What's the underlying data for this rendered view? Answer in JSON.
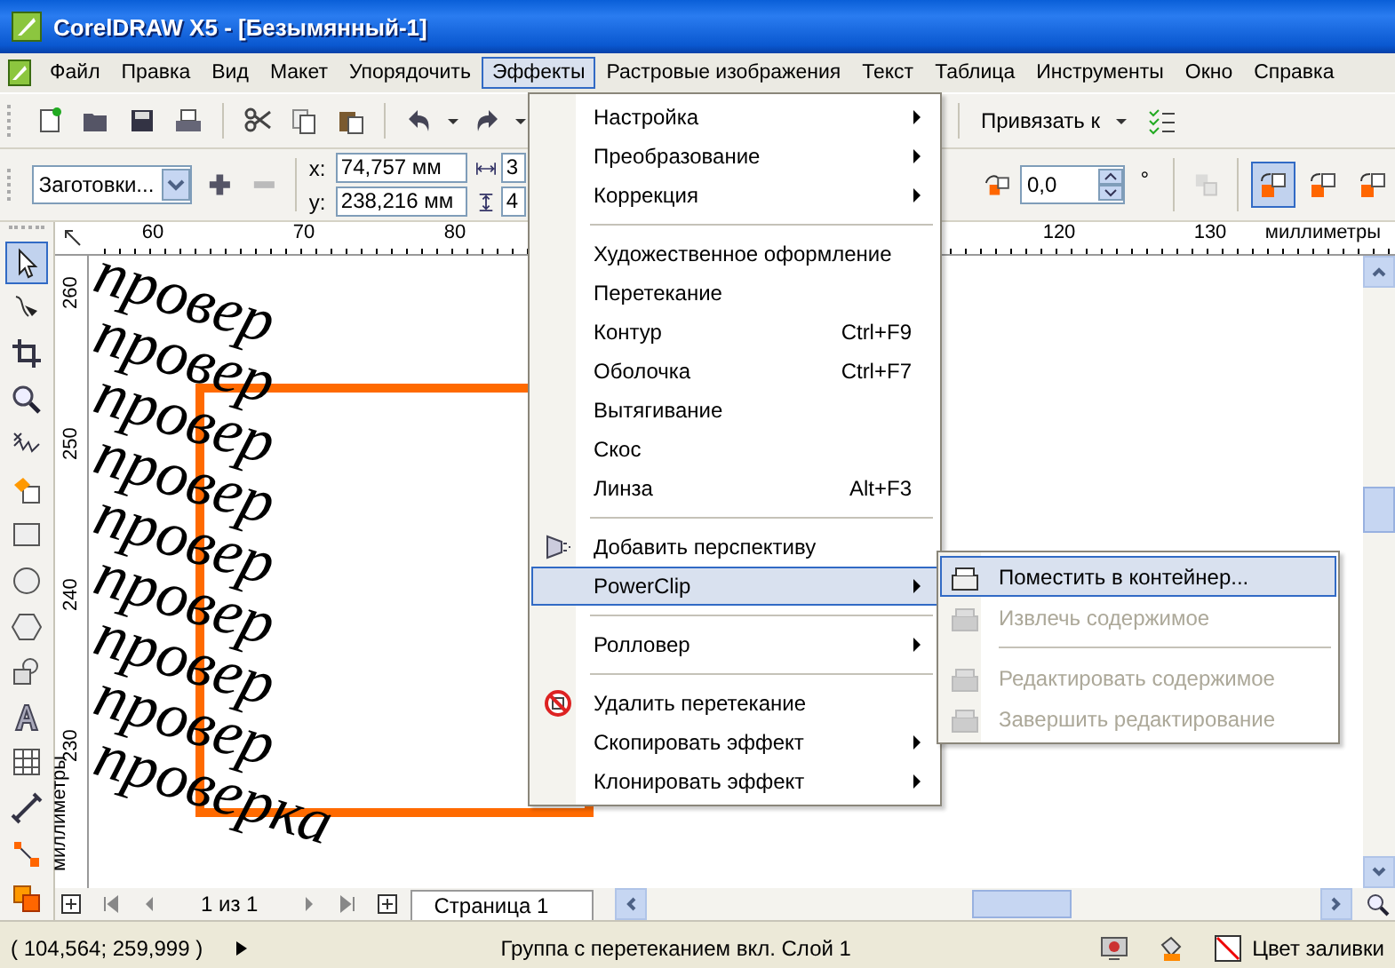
{
  "window": {
    "title": "CorelDRAW X5 - [Безымянный-1]"
  },
  "menu_bar": [
    {
      "label": "Файл",
      "selected": false
    },
    {
      "label": "Правка",
      "selected": false
    },
    {
      "label": "Вид",
      "selected": false
    },
    {
      "label": "Макет",
      "selected": false
    },
    {
      "label": "Упорядочить",
      "selected": false
    },
    {
      "label": "Эффекты",
      "selected": true
    },
    {
      "label": "Растровые изображения",
      "selected": false
    },
    {
      "label": "Текст",
      "selected": false
    },
    {
      "label": "Таблица",
      "selected": false
    },
    {
      "label": "Инструменты",
      "selected": false
    },
    {
      "label": "Окно",
      "selected": false
    },
    {
      "label": "Справка",
      "selected": false
    }
  ],
  "standard_toolbar": {
    "snap_label": "Привязать к"
  },
  "property_bar": {
    "preset": "Заготовки...",
    "x_label": "x:",
    "x_value": "74,757 мм",
    "y_label": "y:",
    "y_value": "238,216 мм",
    "width_value": "3",
    "height_value": "4",
    "angle_value": "0,0",
    "angle_unit": "°",
    "copy_modes": [
      {
        "selected": true
      },
      {
        "selected": false
      },
      {
        "selected": false
      }
    ]
  },
  "horizontal_ruler": {
    "ticks": [
      "60",
      "70",
      "80",
      "120",
      "130"
    ],
    "unit": "миллиметры"
  },
  "vertical_ruler": {
    "ticks": [
      "260",
      "250",
      "240",
      "230"
    ],
    "unit": "миллиметры"
  },
  "toolbox": [
    {
      "selected": true
    },
    {
      "selected": false
    },
    {
      "selected": false
    },
    {
      "selected": false
    },
    {
      "selected": false
    },
    {
      "selected": false
    },
    {
      "selected": false
    },
    {
      "selected": false
    },
    {
      "selected": false
    },
    {
      "selected": false
    },
    {
      "selected": false
    },
    {
      "selected": false
    },
    {
      "selected": false
    },
    {
      "selected": false
    },
    {
      "selected": false
    }
  ],
  "canvas": {
    "blend_copies": [
      "провер",
      "провер",
      "провер",
      "провер",
      "провер",
      "провер",
      "провер",
      "провер",
      "проверка"
    ]
  },
  "effects_menu": [
    {
      "kind": "item",
      "label": "Настройка",
      "submenu": true,
      "selected": false
    },
    {
      "kind": "item",
      "label": "Преобразование",
      "submenu": true,
      "selected": false
    },
    {
      "kind": "item",
      "label": "Коррекция",
      "submenu": true,
      "selected": false
    },
    {
      "kind": "separator"
    },
    {
      "kind": "item",
      "label": "Художественное оформление",
      "selected": false
    },
    {
      "kind": "item",
      "label": "Перетекание",
      "selected": false
    },
    {
      "kind": "item",
      "label": "Контур",
      "shortcut": "Ctrl+F9",
      "selected": false
    },
    {
      "kind": "item",
      "label": "Оболочка",
      "shortcut": "Ctrl+F7",
      "selected": false
    },
    {
      "kind": "item",
      "label": "Вытягивание",
      "selected": false
    },
    {
      "kind": "item",
      "label": "Скос",
      "selected": false
    },
    {
      "kind": "item",
      "label": "Линза",
      "shortcut": "Alt+F3",
      "selected": false
    },
    {
      "kind": "separator"
    },
    {
      "kind": "item",
      "label": "Добавить перспективу",
      "icon": true,
      "selected": false
    },
    {
      "kind": "item",
      "label": "PowerClip",
      "submenu": true,
      "selected": true
    },
    {
      "kind": "separator"
    },
    {
      "kind": "item",
      "label": "Ролловер",
      "submenu": true,
      "selected": false
    },
    {
      "kind": "separator"
    },
    {
      "kind": "item",
      "label": "Удалить перетекание",
      "icon": true,
      "selected": false
    },
    {
      "kind": "item",
      "label": "Скопировать эффект",
      "submenu": true,
      "selected": false
    },
    {
      "kind": "item",
      "label": "Клонировать эффект",
      "submenu": true,
      "selected": false
    }
  ],
  "powerclip_submenu": [
    {
      "kind": "item",
      "label": "Поместить в контейнер...",
      "selected": true,
      "disabled": false
    },
    {
      "kind": "item",
      "label": "Извлечь содержимое",
      "selected": false,
      "disabled": true
    },
    {
      "kind": "separator"
    },
    {
      "kind": "item",
      "label": "Редактировать содержимое",
      "selected": false,
      "disabled": true
    },
    {
      "kind": "item",
      "label": "Завершить редактирование",
      "selected": false,
      "disabled": true
    }
  ],
  "page_nav": {
    "counter": "1 из 1",
    "tab": "Страница 1"
  },
  "status_bar": {
    "coordinates": "( 104,564; 259,999 )",
    "info": "Группа с перетеканием вкл. Слой 1",
    "fill_label": "Цвет заливки"
  }
}
